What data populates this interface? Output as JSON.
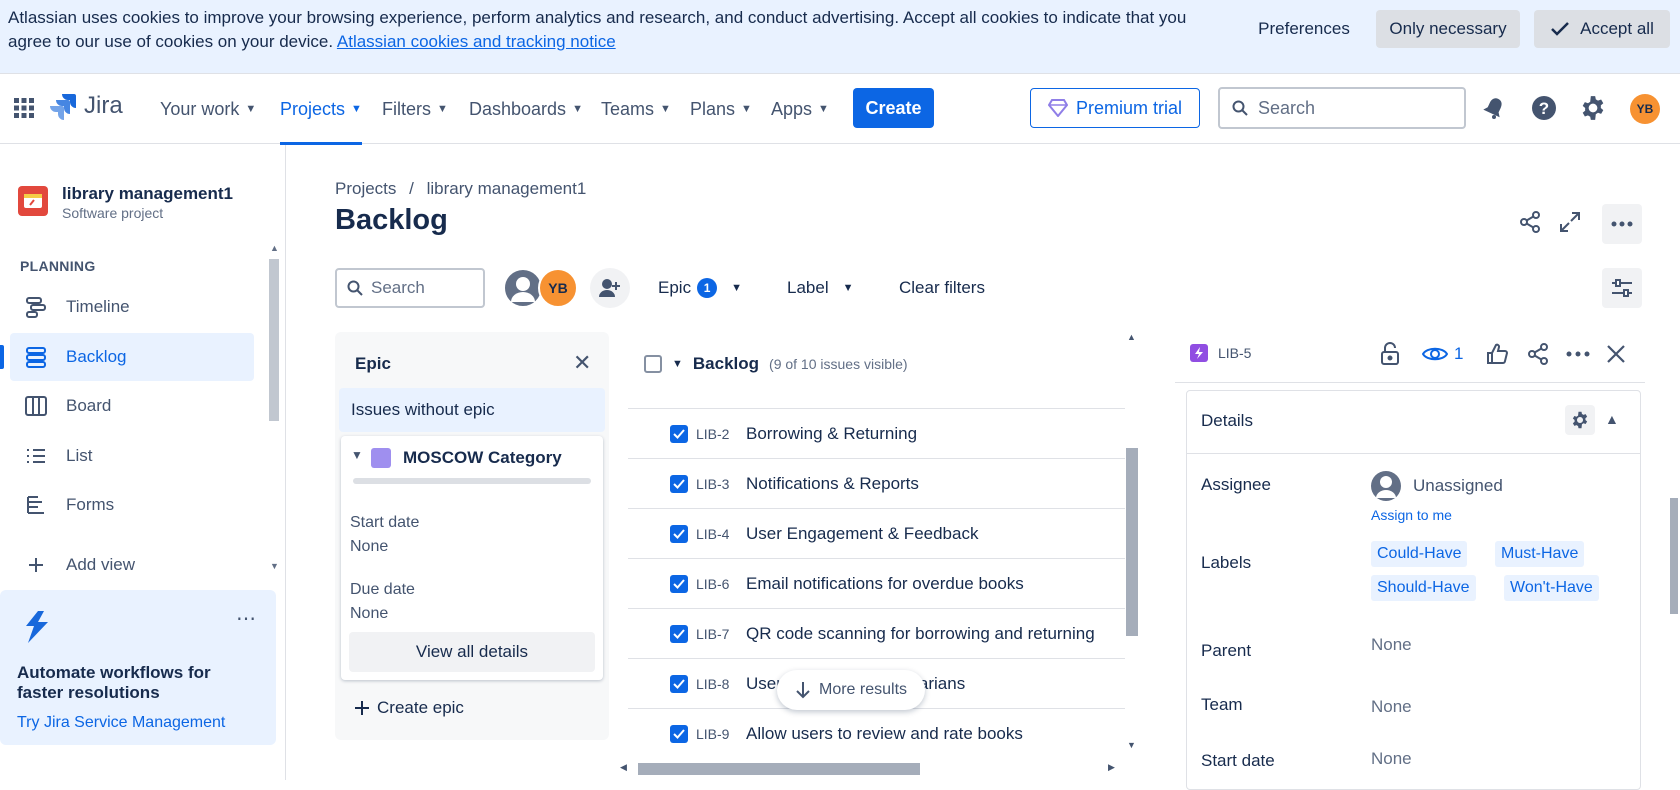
{
  "cookie": {
    "message": "Atlassian uses cookies to improve your browsing experience, perform analytics and research, and conduct advertising. Accept all cookies to indicate that you agree to our use of cookies on your device.",
    "link": "Atlassian cookies and tracking notice",
    "preferences": "Preferences",
    "only_necessary": "Only necessary",
    "accept_all": "Accept all"
  },
  "nav": {
    "logo": "Jira",
    "your_work": "Your work",
    "projects": "Projects",
    "filters": "Filters",
    "dashboards": "Dashboards",
    "teams": "Teams",
    "plans": "Plans",
    "apps": "Apps",
    "create": "Create",
    "premium": "Premium trial",
    "search_placeholder": "Search",
    "avatar": "YB"
  },
  "sidebar": {
    "project_name": "library management1",
    "project_type": "Software project",
    "section": "PLANNING",
    "items": [
      {
        "label": "Timeline"
      },
      {
        "label": "Backlog"
      },
      {
        "label": "Board"
      },
      {
        "label": "List"
      },
      {
        "label": "Forms"
      },
      {
        "label": "Add view"
      }
    ],
    "promo_title": "Automate workflows for faster resolutions",
    "promo_link": "Try Jira Service Management"
  },
  "main": {
    "breadcrumb_root": "Projects",
    "breadcrumb_sep": "/",
    "breadcrumb_project": "library management1",
    "title": "Backlog",
    "search_placeholder": "Search",
    "avatar": "YB",
    "filter_epic": "Epic",
    "filter_epic_count": "1",
    "filter_label": "Label",
    "clear_filters": "Clear filters"
  },
  "epic_panel": {
    "title": "Epic",
    "issues_without_epic": "Issues without epic",
    "epic_name": "MOSCOW Category",
    "epic_color": "#9F8FEF",
    "start_label": "Start date",
    "start_value": "None",
    "due_label": "Due date",
    "due_value": "None",
    "view_all": "View all details",
    "create_epic": "Create epic"
  },
  "backlog": {
    "title": "Backlog",
    "count": "(9 of 10 issues visible)",
    "issues": [
      {
        "key": "LIB-2",
        "summary": "Borrowing & Returning"
      },
      {
        "key": "LIB-3",
        "summary": "Notifications & Reports"
      },
      {
        "key": "LIB-4",
        "summary": "User Engagement & Feedback"
      },
      {
        "key": "LIB-6",
        "summary": "Email notifications for overdue books"
      },
      {
        "key": "LIB-7",
        "summary": "QR code scanning for borrowing and returning"
      },
      {
        "key": "LIB-8",
        "summary": "User dashboard for librarians"
      },
      {
        "key": "LIB-9",
        "summary": "Allow users to review and rate books"
      }
    ],
    "more_results": "More results"
  },
  "detail": {
    "key": "LIB-5",
    "watch_count": "1",
    "section": "Details",
    "assignee_label": "Assignee",
    "assignee_value": "Unassigned",
    "assign_to_me": "Assign to me",
    "labels_label": "Labels",
    "labels": [
      "Could-Have",
      "Must-Have",
      "Should-Have",
      "Won't-Have"
    ],
    "parent_label": "Parent",
    "parent_value": "None",
    "team_label": "Team",
    "team_value": "None",
    "start_label": "Start date",
    "start_value": "None"
  }
}
